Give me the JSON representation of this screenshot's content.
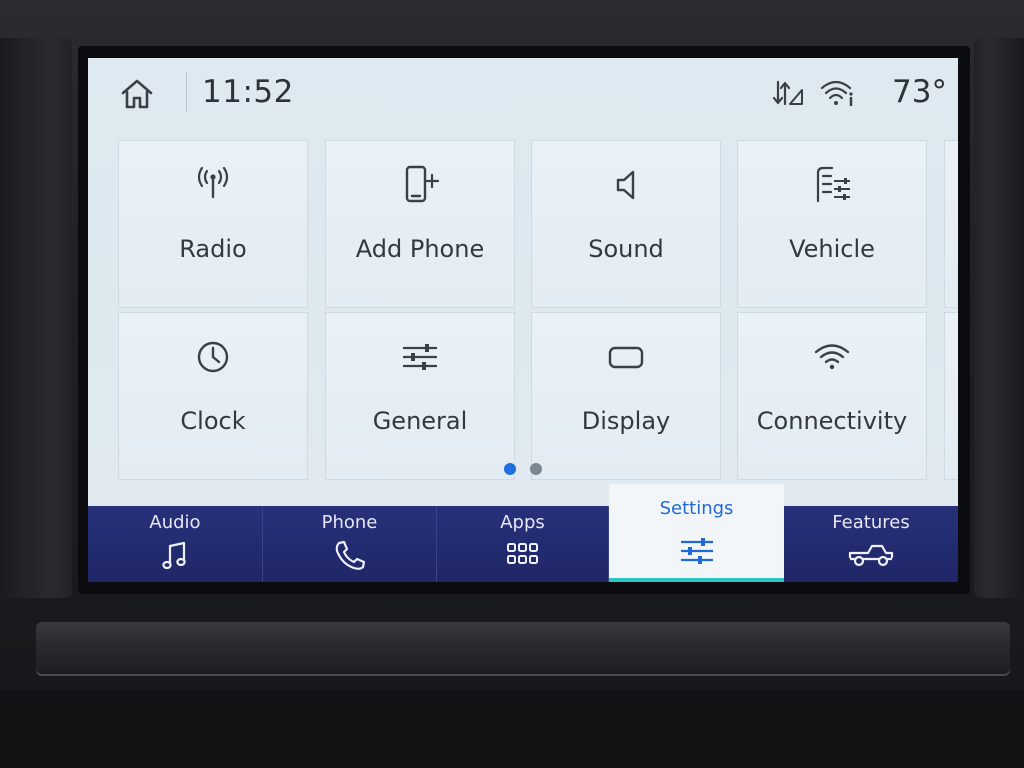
{
  "status": {
    "time": "11:52",
    "temperature": "73°",
    "icons": [
      "home-icon",
      "signal-arrows-icon",
      "wifi-info-icon"
    ]
  },
  "tiles": [
    {
      "label": "Radio",
      "icon": "radio-antenna-icon"
    },
    {
      "label": "Add Phone",
      "icon": "add-phone-icon"
    },
    {
      "label": "Sound",
      "icon": "speaker-icon"
    },
    {
      "label": "Vehicle",
      "icon": "vehicle-settings-icon"
    },
    {
      "label": "Clock",
      "icon": "clock-icon"
    },
    {
      "label": "General",
      "icon": "sliders-icon"
    },
    {
      "label": "Display",
      "icon": "display-icon"
    },
    {
      "label": "Connectivity",
      "icon": "wifi-icon"
    }
  ],
  "pager": {
    "current_page": 1,
    "total_pages": 2
  },
  "bottom_nav": [
    {
      "label": "Audio",
      "icon": "music-note-icon",
      "active": false
    },
    {
      "label": "Phone",
      "icon": "phone-handset-icon",
      "active": false
    },
    {
      "label": "Apps",
      "icon": "apps-grid-icon",
      "active": false
    },
    {
      "label": "Settings",
      "icon": "settings-sliders-icon",
      "active": true
    },
    {
      "label": "Features",
      "icon": "truck-icon",
      "active": false
    }
  ],
  "colors": {
    "accent": "#1f6fe0",
    "nav_background": "#232b70",
    "active_underline": "#2bc6c4",
    "screen_background": "#dfe9f1"
  }
}
